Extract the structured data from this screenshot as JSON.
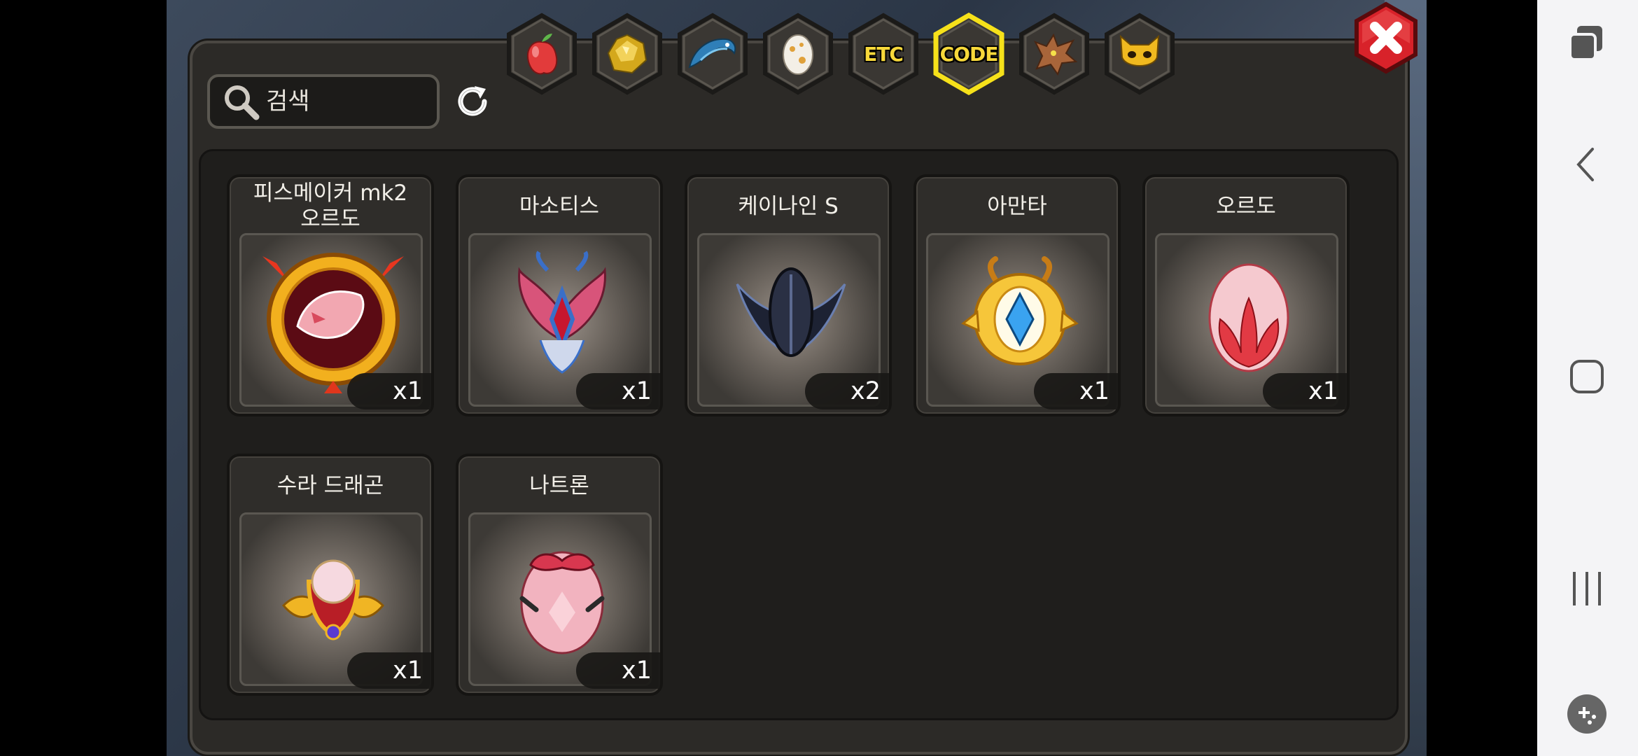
{
  "search": {
    "placeholder": "검색"
  },
  "tabs": [
    {
      "name": "tab-fruit",
      "icon": "fruit-icon",
      "label": ""
    },
    {
      "name": "tab-gold",
      "icon": "gold-ore-icon",
      "label": ""
    },
    {
      "name": "tab-dragon",
      "icon": "blue-dragon-icon",
      "label": ""
    },
    {
      "name": "tab-egg",
      "icon": "egg-icon",
      "label": ""
    },
    {
      "name": "tab-etc",
      "icon": "",
      "label": "ETC"
    },
    {
      "name": "tab-code",
      "icon": "",
      "label": "CODE",
      "selected": true
    },
    {
      "name": "tab-dragon-head",
      "icon": "dragon-head-icon",
      "label": ""
    },
    {
      "name": "tab-mask",
      "icon": "mask-icon",
      "label": ""
    }
  ],
  "items": [
    {
      "name": "피스메이커 mk2\n오르도",
      "qty": "x1",
      "icon": "peacemaker-emblem-icon"
    },
    {
      "name": "마소티스",
      "qty": "x1",
      "icon": "masotis-emblem-icon"
    },
    {
      "name": "케이나인 S",
      "qty": "x2",
      "icon": "canine-s-emblem-icon"
    },
    {
      "name": "아만타",
      "qty": "x1",
      "icon": "amanta-emblem-icon"
    },
    {
      "name": "오르도",
      "qty": "x1",
      "icon": "ordo-egg-icon"
    },
    {
      "name": "수라 드래곤",
      "qty": "x1",
      "icon": "sura-dragon-emblem-icon"
    },
    {
      "name": "나트론",
      "qty": "x1",
      "icon": "natron-egg-icon"
    }
  ],
  "colors": {
    "accent": "#f7d83a",
    "panel": "#2c2a27",
    "close": "#d8222a"
  }
}
